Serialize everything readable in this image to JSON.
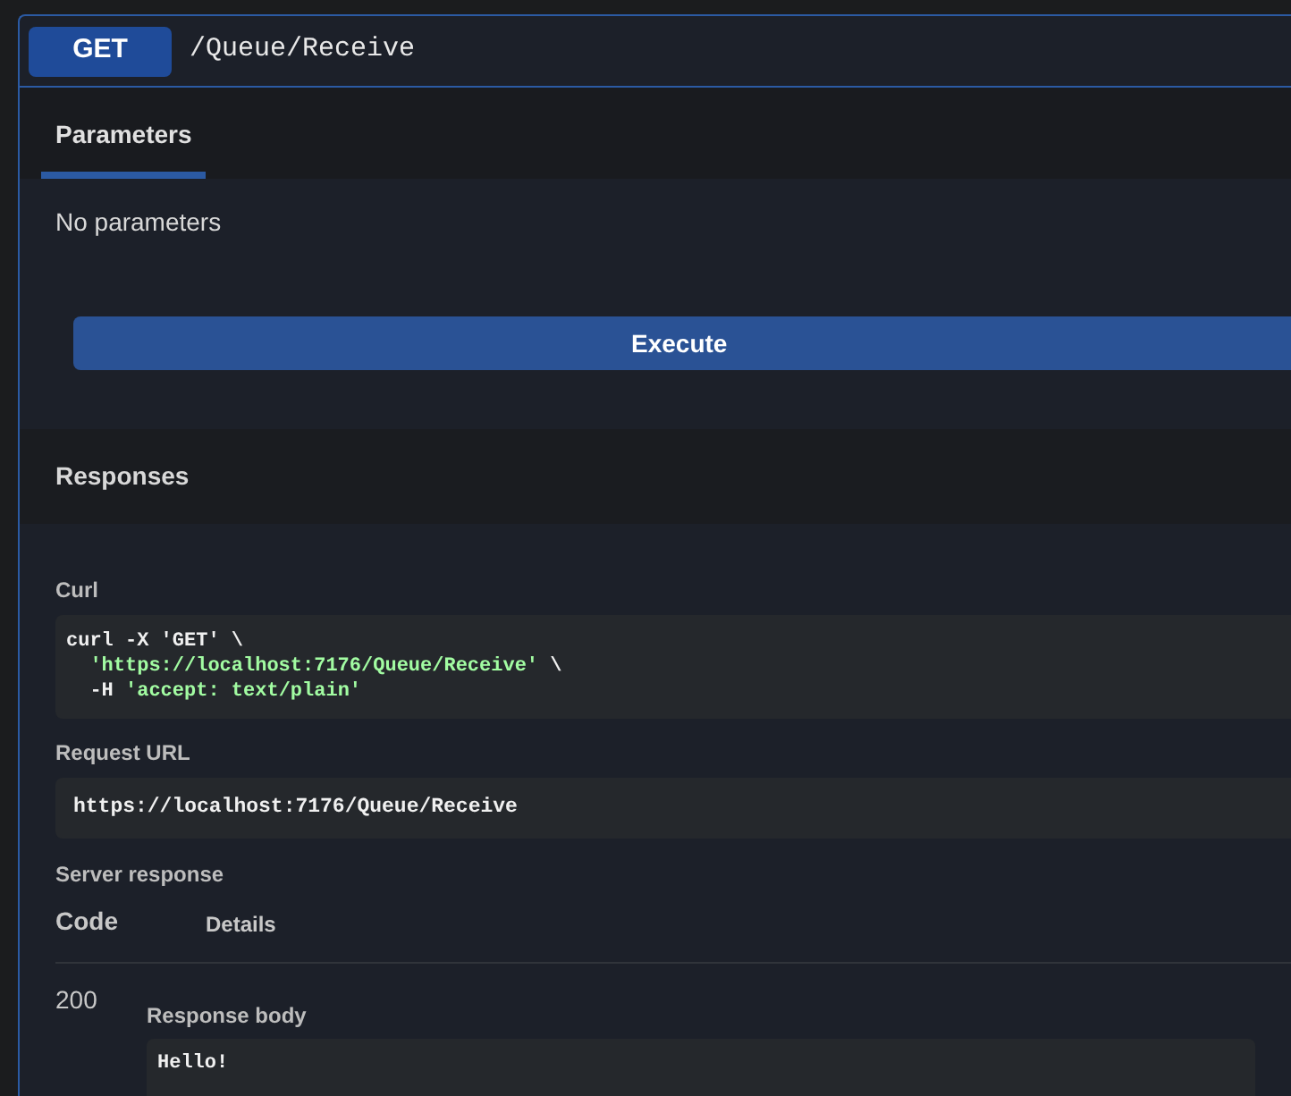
{
  "operation": {
    "method": "GET",
    "path": "/Queue/Receive"
  },
  "tabs": [
    {
      "label": "Parameters",
      "selected": true
    }
  ],
  "parameters_text": "No parameters",
  "execute_button": "Execute",
  "responses_title": "Responses",
  "curl": {
    "label": "Curl",
    "lines": [
      {
        "indent": false,
        "segments": [
          {
            "kind": "plain",
            "text": "curl -X 'GET' \\"
          }
        ]
      },
      {
        "indent": true,
        "segments": [
          {
            "kind": "string",
            "text": "'https://localhost:7176/Queue/Receive'"
          },
          {
            "kind": "plain",
            "text": " \\"
          }
        ]
      },
      {
        "indent": true,
        "segments": [
          {
            "kind": "plain",
            "text": "-H "
          },
          {
            "kind": "string",
            "text": "'accept: text/plain'"
          }
        ]
      }
    ]
  },
  "request_url": {
    "label": "Request URL",
    "value": "https://localhost:7176/Queue/Receive"
  },
  "server_response": {
    "title": "Server response",
    "columns": [
      "Code",
      "Details"
    ],
    "code": "200",
    "body_label": "Response body",
    "body": "Hello!"
  }
}
